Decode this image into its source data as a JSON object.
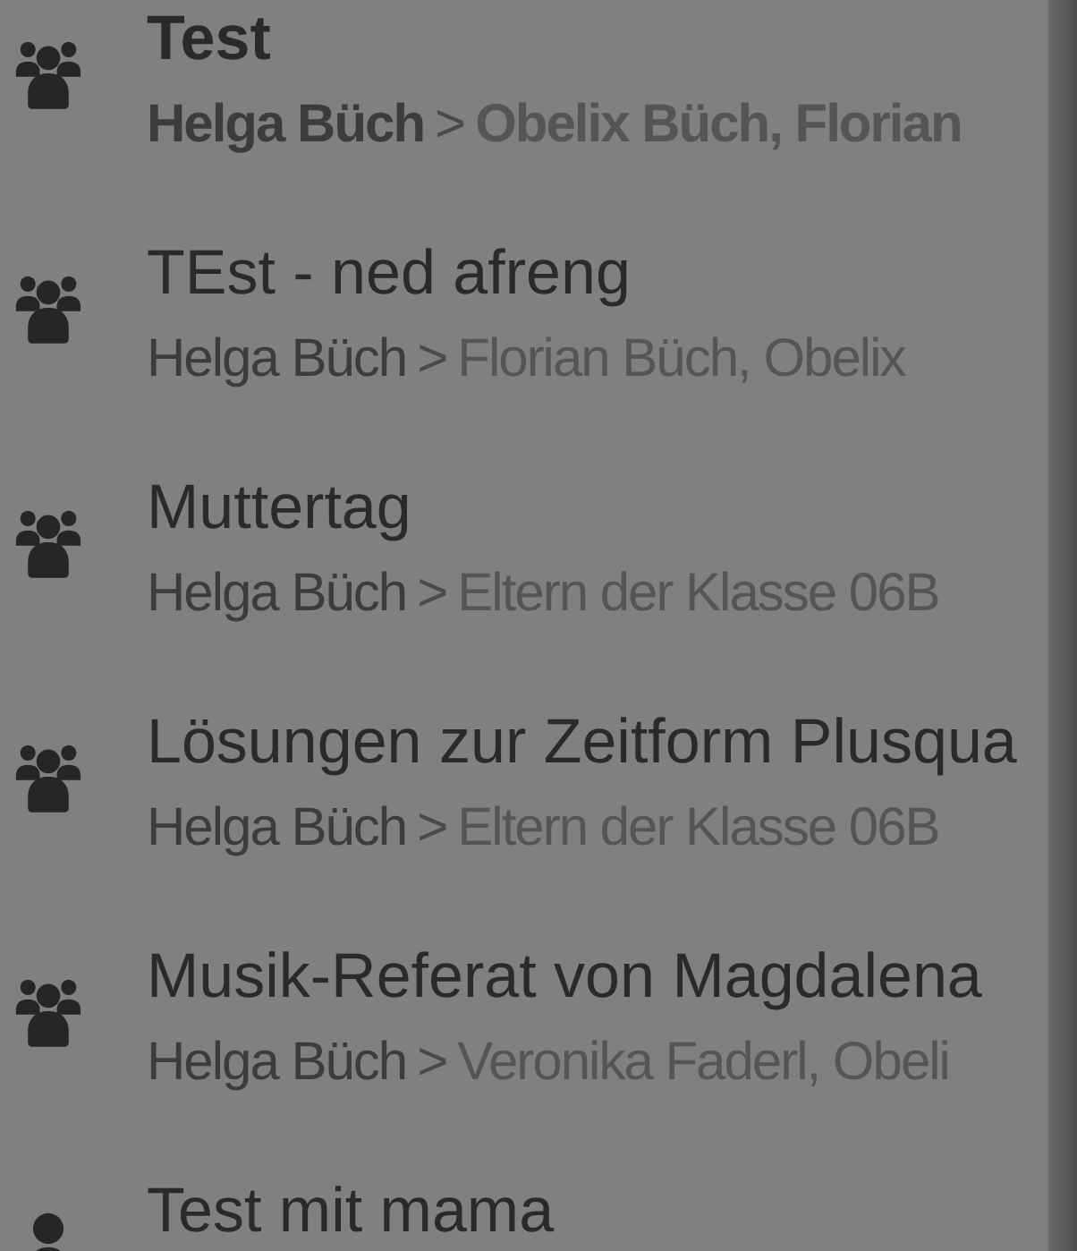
{
  "conversations": [
    {
      "kind": "group",
      "title": "Test",
      "sender": "Helga Büch",
      "separator": ">",
      "recipients": "Obelix Büch, Florian",
      "unread": true
    },
    {
      "kind": "group",
      "title": "TEst - ned afreng",
      "sender": "Helga Büch",
      "separator": ">",
      "recipients": "Florian Büch, Obelix",
      "unread": false
    },
    {
      "kind": "group",
      "title": "Muttertag",
      "sender": "Helga Büch",
      "separator": ">",
      "recipients": "Eltern der Klasse 06B",
      "unread": false
    },
    {
      "kind": "group",
      "title": "Lösungen zur Zeitform Plusqua",
      "sender": "Helga Büch",
      "separator": ">",
      "recipients": "Eltern der Klasse 06B",
      "unread": false
    },
    {
      "kind": "group",
      "title": "Musik-Referat von Magdalena",
      "sender": "Helga Büch",
      "separator": ">",
      "recipients": "Veronika Faderl, Obeli",
      "unread": false
    },
    {
      "kind": "person",
      "title": "Test mit mama",
      "unread": false
    }
  ]
}
